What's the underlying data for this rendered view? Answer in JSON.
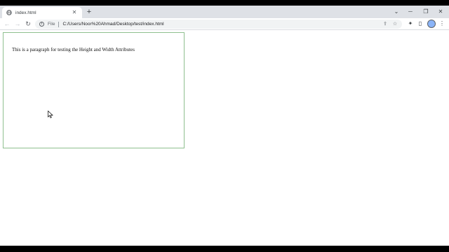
{
  "tab": {
    "title": "index.html",
    "close_label": "✕"
  },
  "new_tab_label": "+",
  "window_controls": {
    "minimize": "─",
    "restore": "❐",
    "close": "✕",
    "tab_search": "⌄"
  },
  "nav": {
    "back": "←",
    "forward": "→",
    "reload": "↻"
  },
  "address": {
    "scheme_label": "File",
    "url": "C:/Users/Noor%20Ahmad/Desktop/test/index.html"
  },
  "toolbar_icons": {
    "share": "⇪",
    "bookmark": "☆",
    "extensions": "✦",
    "sidepanel": "▯",
    "menu": "⋮"
  },
  "page": {
    "paragraph": "This is a paragraph for testing the Height and Width Attributes"
  },
  "colors": {
    "box_border": "#8fbf8f",
    "tabstrip": "#dee1e6",
    "omnibox": "#f1f3f4"
  }
}
